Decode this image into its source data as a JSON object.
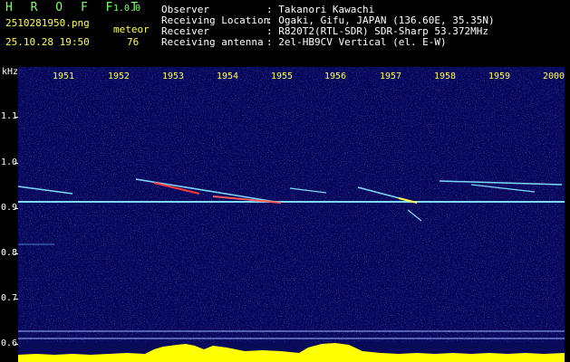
{
  "header": {
    "app_title": "H R O F F T",
    "app_version": "1.0.0",
    "file_name": "2510281950.png",
    "mode_label": "meteor",
    "datetime": "25.10.28 19:50",
    "meteor_count": "76"
  },
  "info": [
    {
      "label": "Observer",
      "value": ": Takanori Kawachi"
    },
    {
      "label": "Receiving Location",
      "value": ": Ogaki, Gifu, JAPAN (136.60E, 35.35N)"
    },
    {
      "label": "Receiver",
      "value": ": R820T2(RTL-SDR) SDR-Sharp 53.372MHz"
    },
    {
      "label": "Receiving antenna",
      "value": ": 2el-HB9CV Vertical (el. E-W)"
    }
  ],
  "axis": {
    "unit": "kHz",
    "y_labels": [
      "1.1",
      "1.0",
      "0.9",
      "0.8",
      "0.7",
      "0.6"
    ],
    "x_labels": [
      "1951",
      "1952",
      "1953",
      "1954",
      "1955",
      "1956",
      "1957",
      "1958",
      "1959",
      "2000"
    ]
  },
  "colors": {
    "background": "#06065a",
    "trace": "#7fd9ff",
    "meteor_hot": "#ff3a3a",
    "bar": "#ffff00",
    "text_green": "#7cff6a",
    "text_yellow": "#ffff4a"
  }
}
